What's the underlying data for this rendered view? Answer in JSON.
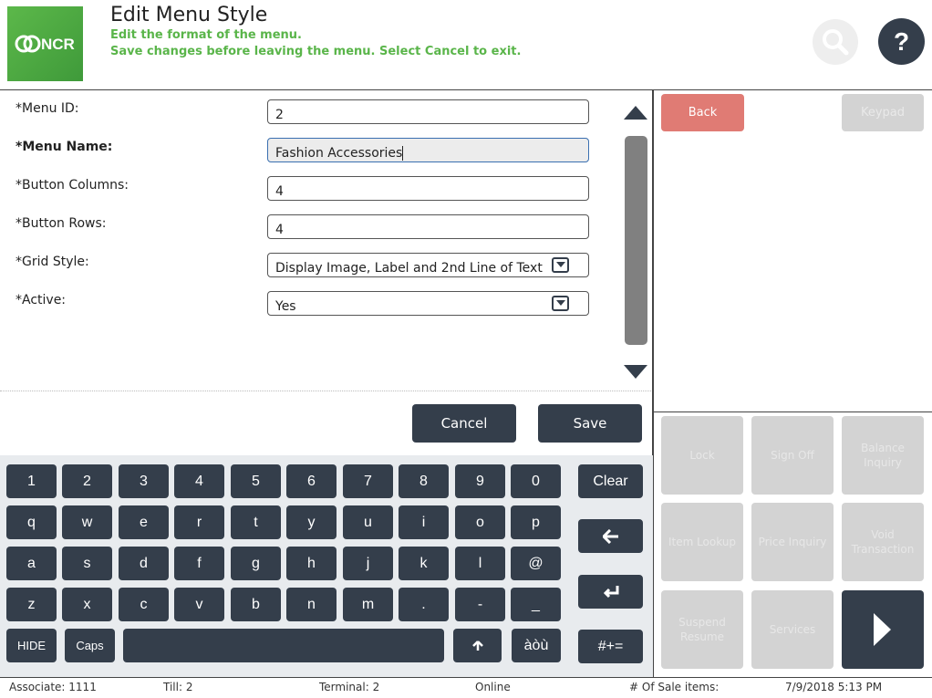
{
  "header": {
    "logo_text": "NCR",
    "title": "Edit Menu Style",
    "subtitle1": "Edit the format of the menu.",
    "subtitle2": "Save changes before leaving the menu. Select Cancel to exit.",
    "help_label": "?"
  },
  "form": {
    "fields": [
      {
        "label": "*Menu ID:",
        "value": "2"
      },
      {
        "label": "*Menu Name:",
        "value": "Fashion Accessories"
      },
      {
        "label": "*Button Columns:",
        "value": "4"
      },
      {
        "label": "*Button Rows:",
        "value": "4"
      },
      {
        "label": "*Grid Style:",
        "value": "Display Image, Label and 2nd Line of Text"
      },
      {
        "label": "*Active:",
        "value": "Yes"
      }
    ],
    "cancel_label": "Cancel",
    "save_label": "Save"
  },
  "keyboard": {
    "row1": [
      "1",
      "2",
      "3",
      "4",
      "5",
      "6",
      "7",
      "8",
      "9",
      "0"
    ],
    "row2": [
      "q",
      "w",
      "e",
      "r",
      "t",
      "y",
      "u",
      "i",
      "o",
      "p"
    ],
    "row3": [
      "a",
      "s",
      "d",
      "f",
      "g",
      "h",
      "j",
      "k",
      "l",
      "@"
    ],
    "row4": [
      "z",
      "x",
      "c",
      "v",
      "b",
      "n",
      "m",
      ".",
      "-",
      "_"
    ],
    "hide": "HIDE",
    "caps": "Caps",
    "accents": "àòù",
    "clear": "Clear",
    "symbols": "#+="
  },
  "right_panel": {
    "back_label": "Back",
    "keypad_label": "Keypad",
    "functions": [
      "Lock",
      "Sign Off",
      "Balance Inquiry",
      "Item Lookup",
      "Price Inquiry",
      "Void Transaction",
      "Suspend Resume",
      "Services"
    ]
  },
  "status": {
    "associate": "Associate: 1111",
    "till": "Till: 2",
    "terminal": "Terminal: 2",
    "online": "Online",
    "sale_items": "# Of Sale items:",
    "datetime": "7/9/2018 5:13 PM"
  },
  "colors": {
    "dark": "#343e4b",
    "accent_green": "#5ab54a",
    "back_red": "#e07b74",
    "disabled": "#d3d3d3"
  }
}
